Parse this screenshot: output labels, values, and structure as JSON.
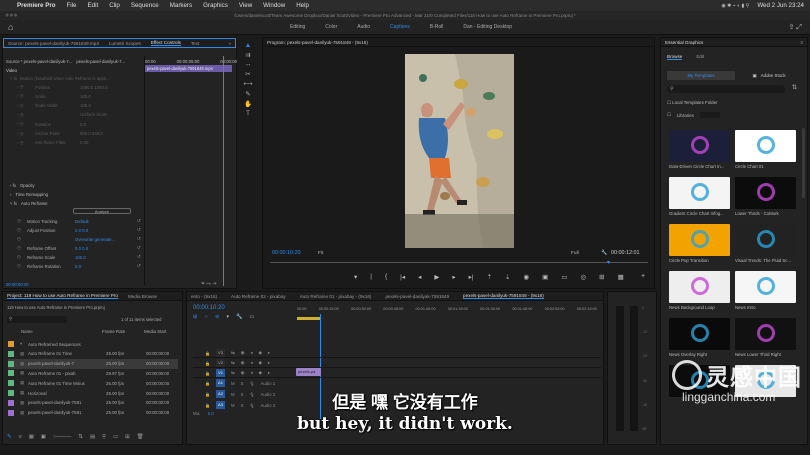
{
  "mac_menu": {
    "app": "Premiere Pro",
    "items": [
      "File",
      "Edit",
      "Clip",
      "Sequence",
      "Markers",
      "Graphics",
      "View",
      "Window",
      "Help"
    ],
    "clock": "Wed 2 Jun 23:24"
  },
  "window_title": "/Users/danielscott/Team Awesome Dropbox/Daniel Scott/Video - Premiere Pro Advanced - Mar 21/0 Completed Files/118 How to use Auto Reframe in Premiere Pro.prproj *",
  "workspaces": [
    "Editing",
    "Color",
    "Audio",
    "Captions",
    "B-Roll",
    "Dan - Editing Desktop"
  ],
  "source_panel": {
    "tabs": [
      "Source: pexels-pavel-danilyuk-7591849.mp4",
      "Lumetri Scopes",
      "Effect Controls",
      "Text"
    ],
    "active_tab": "Effect Controls",
    "source_label": "Source * pexels-pavel-danilyuk-7...",
    "clip_label": "pexels-pavel-danilyuk-7...",
    "timecodes": [
      "00:00",
      "00:00:05:00",
      "00:00:00"
    ],
    "clip_bar_label": "pexels-pavel-danilyuk-7591849.mp4",
    "section": "Video",
    "motion_label": "Motion (Disabled when Auto Reframe is appli...",
    "motion_props": [
      {
        "name": "Position",
        "value": "1080.0    1080.0"
      },
      {
        "name": "Scale",
        "value": "100.0"
      },
      {
        "name": "Scale Width",
        "value": "100.0"
      },
      {
        "name": "",
        "value": "Uniform Scale"
      },
      {
        "name": "Rotation",
        "value": "0.0"
      },
      {
        "name": "Anchor Point",
        "value": "960.0    540.0"
      },
      {
        "name": "Anti-flicker Filter",
        "value": "0.00"
      }
    ],
    "fx_groups": [
      "Opacity",
      "Time Remapping",
      "Auto Reframe"
    ],
    "analyze_label": "Analyze",
    "auto_reframe": [
      {
        "name": "Motion Tracking",
        "value": "Default"
      },
      {
        "name": "Adjust Position",
        "value": "0.0      0.0"
      },
      {
        "name": "",
        "value": "Overwrite generate..."
      },
      {
        "name": "Reframe Offset",
        "value": "0.0      0.0"
      },
      {
        "name": "Reframe Scale",
        "value": "100.0"
      },
      {
        "name": "Reframe Rotation",
        "value": "0.0"
      }
    ],
    "footer_timecode": "00:00:00:20"
  },
  "program_monitor": {
    "title": "Program: pexels-pavel-danilyuk-7591849 - (9x16)",
    "timecode": "00:00:10:20",
    "fit": "Fit",
    "quality": "Full",
    "duration": "00:00:12:01"
  },
  "essential_graphics": {
    "title": "Essential Graphics",
    "tabs": [
      "Browse",
      "Edit"
    ],
    "sub_tabs": [
      "My Templates",
      "Adobe Stock"
    ],
    "local_folder": "Local Templates Folder",
    "libraries": "Libraries",
    "templates": [
      {
        "name": "Data-Driven Circle Chart In...",
        "color": "#1b1f3a"
      },
      {
        "name": "Circle Chart 01",
        "color": "#ffffff"
      },
      {
        "name": "Gradient Circle Chart Infog...",
        "color": "#f4f4f4"
      },
      {
        "name": "Lower Thirds - CoMork",
        "color": "#0c0c0c"
      },
      {
        "name": "Circle Pop Transition",
        "color": "#f3a300"
      },
      {
        "name": "Visual Trends: The Fluid Sc...",
        "color": "#222222"
      },
      {
        "name": "News Background Loop",
        "color": "#eeeeee"
      },
      {
        "name": "News Intro",
        "color": "#f6f6f6"
      },
      {
        "name": "News Overlay Right",
        "color": "#0a0a0a"
      },
      {
        "name": "News Lower Third Right",
        "color": "#111111"
      },
      {
        "name": "",
        "color": "#0c0c0c"
      },
      {
        "name": "",
        "color": "#e7e7e7"
      }
    ]
  },
  "project_panel": {
    "tabs": [
      "Project: 119 How to use Auto Reframe in Premiere Pro",
      "Media Browse"
    ],
    "path": "119 How to use Auto Reframe in Premiere Pro.prproj",
    "selected_count": "1 of 11 items selected",
    "columns": [
      "Name",
      "Frame Rate",
      "Media Start"
    ],
    "items": [
      {
        "name": "Auto Reframed Sequences",
        "fps": "",
        "start": "",
        "color": "#e09a3a"
      },
      {
        "name": "Auto Reframe 01 Time",
        "fps": "25.00 fps",
        "start": "00:00:00:00",
        "color": "#5fb87f"
      },
      {
        "name": "pexels-pavel-danilyuk-7",
        "fps": "25.00 fps",
        "start": "00:00:00:00",
        "color": "#5fb87f"
      },
      {
        "name": "Auto Reframe 01 - pixab",
        "fps": "29.97 fps",
        "start": "00:00:00:00",
        "color": "#5fb87f"
      },
      {
        "name": "Auto Reframe 01 Time Minus",
        "fps": "25.00 fps",
        "start": "00:00:00:00",
        "color": "#5fb87f"
      },
      {
        "name": "Horizonal",
        "fps": "25.00 fps",
        "start": "00:00:00:00",
        "color": "#5fb87f"
      },
      {
        "name": "pexels-pavel-danilyuk-7591",
        "fps": "25.00 fps",
        "start": "00:00:00:00",
        "color": "#a070d0"
      },
      {
        "name": "pexels-pavel-danilyuk-7591",
        "fps": "25.00 fps",
        "start": "00:00:00:00",
        "color": "#a070d0"
      }
    ]
  },
  "timeline": {
    "tabs": [
      "ento - (9x16)",
      "Auto Reframe 02 - pixabay",
      "Auto Reframe 01 - pixabay - (9x16)",
      "pexels-pavel-danilyuk-7591849",
      "pexels-pavel-danilyuk-7591849 - (9x16)"
    ],
    "active_tab": "pexels-pavel-danilyuk-7591849 - (9x16)",
    "timecode": "00:00:10:20",
    "ruler": [
      "00:00",
      "00:00:15:00",
      "00:00:30:00",
      "00:00:45:00",
      "00:01:00:00",
      "00:01:15:00",
      "00:01:30:00",
      "00:01:45:00",
      "00:02:00:00",
      "00:02:15:00"
    ],
    "video_tracks": [
      "V3",
      "V2",
      "V1"
    ],
    "audio_tracks": [
      {
        "id": "A1",
        "name": "Audio 1"
      },
      {
        "id": "A2",
        "name": "Audio 2"
      },
      {
        "id": "A3",
        "name": "Audio 3"
      }
    ],
    "mix_label": "Mix",
    "mix_value": "0.0",
    "clip_label": "pexels-pa"
  },
  "subtitles": {
    "zh": "但是 嘿 它没有工作",
    "en": "but hey, it didn't work."
  },
  "watermark": {
    "cn": "灵感中国",
    "url": "lingganchina.com"
  }
}
